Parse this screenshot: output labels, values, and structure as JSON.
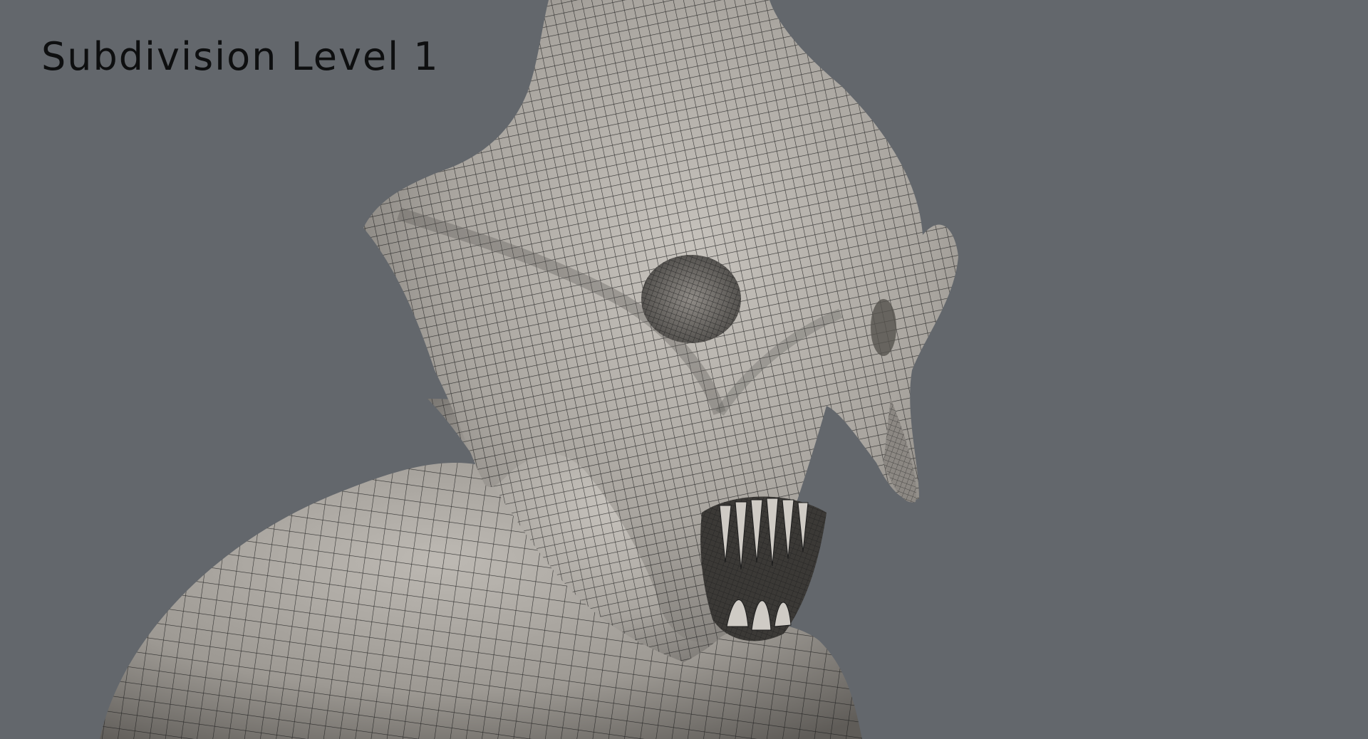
{
  "viewport": {
    "overlay_label": "Subdivision Level 1",
    "background_color": "#63676c",
    "model": {
      "subject": "creature-head-sculpt",
      "display_mode": "wireframe-on-shaded",
      "surface_color": "#aeaba6",
      "wire_color": "#1c1c1c"
    }
  }
}
